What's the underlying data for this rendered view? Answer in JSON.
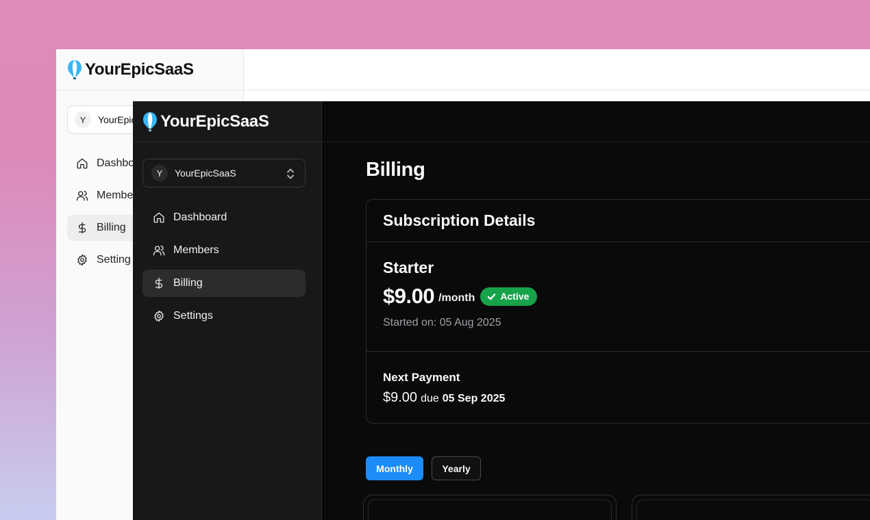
{
  "back_window": {
    "brand": "YourEpicSaaS",
    "workspace": {
      "avatar": "Y",
      "name": "YourEpic"
    },
    "nav": [
      {
        "label": "Dashbo",
        "icon": "home-icon"
      },
      {
        "label": "Membe",
        "icon": "users-icon"
      },
      {
        "label": "Billing",
        "icon": "dollar-icon",
        "active": true
      },
      {
        "label": "Setting",
        "icon": "gear-icon"
      }
    ]
  },
  "front_window": {
    "brand": "YourEpicSaaS",
    "workspace": {
      "avatar": "Y",
      "name": "YourEpicSaaS"
    },
    "nav": [
      {
        "label": "Dashboard",
        "icon": "home-icon"
      },
      {
        "label": "Members",
        "icon": "users-icon"
      },
      {
        "label": "Billing",
        "icon": "dollar-icon",
        "active": true
      },
      {
        "label": "Settings",
        "icon": "gear-icon"
      }
    ],
    "page_title": "Billing",
    "subscription": {
      "header": "Subscription Details",
      "plan": "Starter",
      "price": "$9.00",
      "period": "/month",
      "status": "Active",
      "started": "Started on: 05 Aug 2025",
      "next_payment_title": "Next Payment",
      "next_amount": "$9.00",
      "due_word": "due",
      "due_date": "05 Sep 2025"
    },
    "billing_toggle": {
      "monthly": "Monthly",
      "yearly": "Yearly",
      "selected": "Monthly"
    }
  },
  "colors": {
    "accent_blue": "#1d8cf8",
    "status_green": "#16a34a",
    "logo_blue": "#38b6f5"
  }
}
